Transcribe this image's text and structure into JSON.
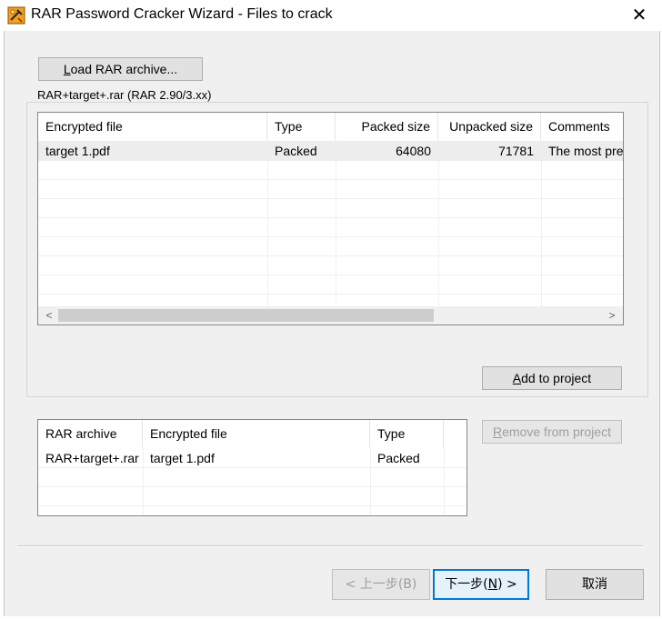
{
  "window": {
    "title": "RAR Password Cracker Wizard - Files to crack",
    "close_glyph": "✕",
    "app_icon": "tool-key-icon"
  },
  "toolbar": {
    "load_label_accel": "L",
    "load_label_rest": "oad RAR archive..."
  },
  "archive_group": {
    "label": "RAR+target+.rar (RAR 2.90/3.xx)"
  },
  "files_list": {
    "columns": [
      "Encrypted file",
      "Type",
      "Packed size",
      "Unpacked size",
      "Comments"
    ],
    "rows": [
      {
        "file": "target 1.pdf",
        "type": "Packed",
        "packed": "64080",
        "unpacked": "71781",
        "comments": "The most pref"
      }
    ],
    "scroll_left": "<",
    "scroll_right": ">"
  },
  "add_button": {
    "accel": "A",
    "rest": "dd to project"
  },
  "remove_button": {
    "accel": "R",
    "rest": "emove from project"
  },
  "project_list": {
    "columns": [
      "RAR archive",
      "Encrypted file",
      "Type"
    ],
    "rows": [
      {
        "archive": "RAR+target+.rar",
        "file": "target 1.pdf",
        "type": "Packed"
      }
    ]
  },
  "nav": {
    "back_label": "< 上一步(B)",
    "next_pre": "下一步(",
    "next_accel": "N",
    "next_post": ") >",
    "cancel_label": "取消"
  }
}
